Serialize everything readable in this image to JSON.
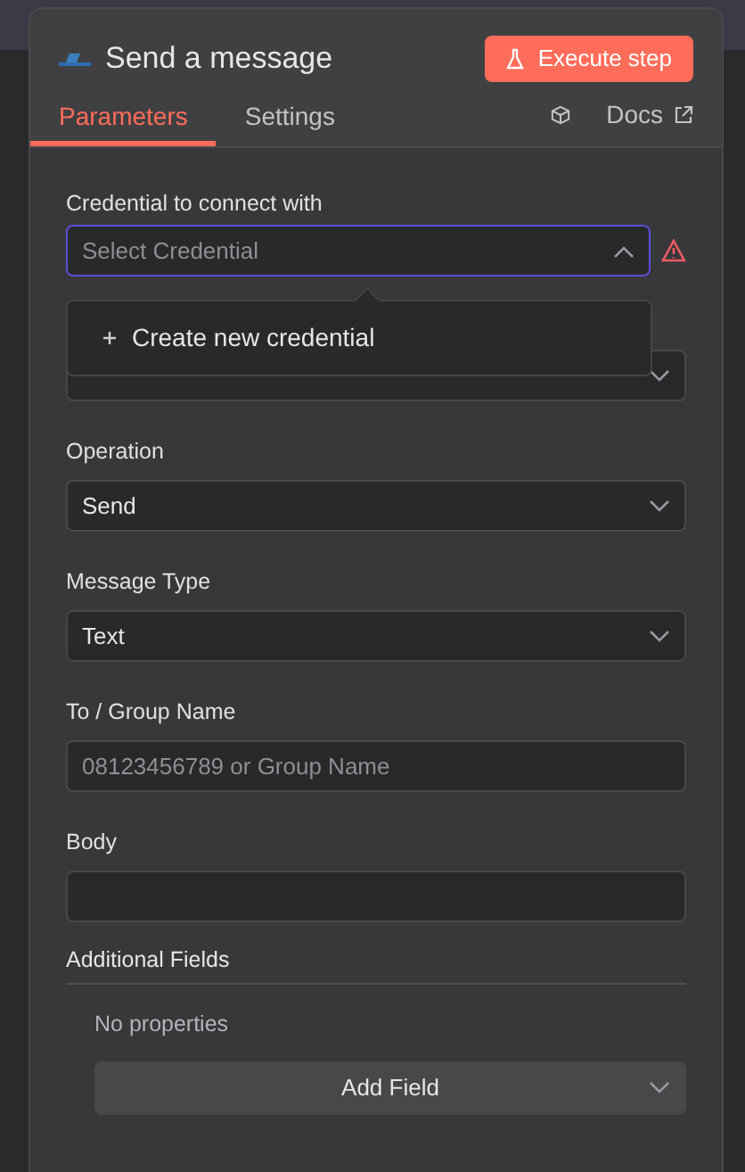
{
  "node": {
    "title": "Send a message",
    "execute_button": "Execute step"
  },
  "tabs": [
    {
      "label": "Parameters",
      "selected": true
    },
    {
      "label": "Settings",
      "selected": false
    }
  ],
  "docs_link": "Docs",
  "credential": {
    "label": "Credential to connect with",
    "placeholder": "Select Credential",
    "expanded": true,
    "warning": true
  },
  "credential_menu": {
    "items": [
      "Create new credential"
    ]
  },
  "fields": [
    {
      "kind": "select"
    },
    {
      "kind": "select",
      "label": "Operation",
      "value": "Send"
    },
    {
      "kind": "select",
      "label": "Message Type",
      "value": "Text"
    },
    {
      "kind": "input",
      "label": "To / Group Name",
      "placeholder": "08123456789 or Group Name"
    },
    {
      "kind": "textarea",
      "label": "Body"
    }
  ],
  "additional_fields": {
    "title": "Additional Fields",
    "empty_text": "No properties",
    "add_button": "Add Field"
  }
}
